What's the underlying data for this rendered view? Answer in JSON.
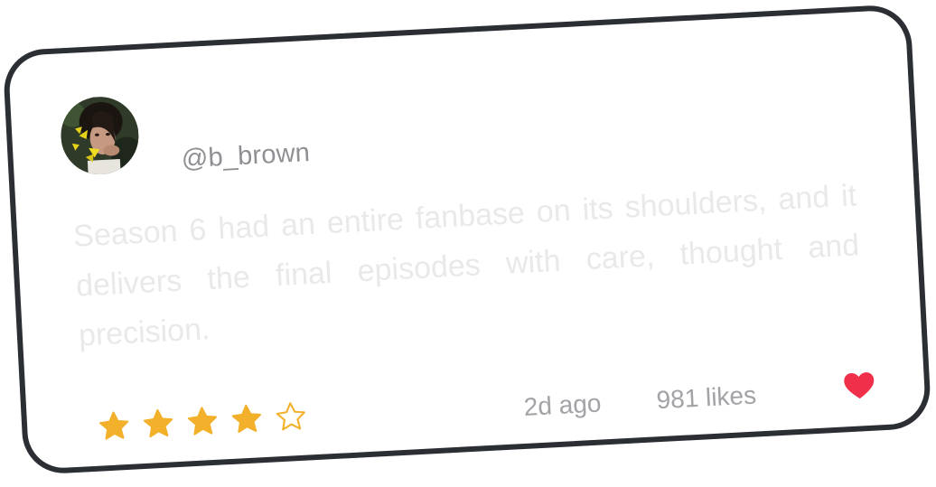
{
  "user": {
    "handle": "@b_brown",
    "avatar_icon": "user-avatar-photo"
  },
  "review": {
    "text": "Season 6 had an entire fanbase on its shoulders, and it delivers the final episodes with care, thought and precision."
  },
  "rating": {
    "value": 4,
    "max": 5,
    "filled_icon": "star-filled-icon",
    "empty_icon": "star-outline-icon",
    "color": "#f3b02a"
  },
  "meta": {
    "time": "2d ago",
    "likes": "981 likes"
  },
  "like": {
    "icon": "heart-icon",
    "color": "#f0304a",
    "liked": true
  },
  "colors": {
    "card_border": "#2b2e33",
    "review_text": "#e9e9ec",
    "meta_text": "#a2a2a7"
  }
}
